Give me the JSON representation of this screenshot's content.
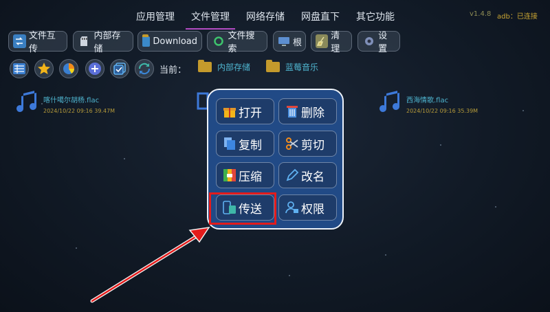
{
  "header": {
    "tabs": [
      {
        "label": "应用管理",
        "active": false
      },
      {
        "label": "文件管理",
        "active": true
      },
      {
        "label": "网络存储",
        "active": false
      },
      {
        "label": "网盘直下",
        "active": false
      },
      {
        "label": "其它功能",
        "active": false
      }
    ],
    "version": "v1.4.8",
    "adb_status": "adb：已连接"
  },
  "toolbar": {
    "transfer": "文件互传",
    "internal": "内部存储",
    "download": "Download",
    "search": "文件搜索",
    "root": "根",
    "clean": "清理",
    "settings": "设置"
  },
  "path": {
    "label": "当前：",
    "crumbs": [
      "内部存储",
      "蓝莓音乐"
    ]
  },
  "files": [
    {
      "name": "喀什噶尔胡杨.flac",
      "meta": "2024/10/22 09:16  39.47M"
    },
    {
      "name": "西海情歌.flac",
      "meta": "2024/10/22 09:16  35.39M"
    }
  ],
  "menu": {
    "open": "打开",
    "delete": "删除",
    "copy": "复制",
    "cut": "剪切",
    "compress": "压缩",
    "rename": "改名",
    "send": "传送",
    "permission": "权限"
  },
  "colors": {
    "accent": "#b44cc4",
    "link": "#4fb6d1",
    "menu_bg": "#214a86",
    "highlight": "#e41b1b",
    "warning": "#c9a533"
  }
}
